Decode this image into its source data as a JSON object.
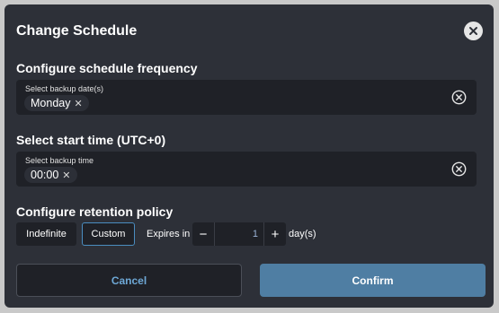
{
  "dialog": {
    "title": "Change Schedule",
    "close_icon": "close-icon"
  },
  "frequency": {
    "heading": "Configure schedule frequency",
    "field_label": "Select backup date(s)",
    "chips": [
      "Monday"
    ],
    "clear_icon": "circle-x-icon"
  },
  "start_time": {
    "heading": "Select start time (UTC+0)",
    "field_label": "Select backup time",
    "chips": [
      "00:00"
    ],
    "clear_icon": "circle-x-icon"
  },
  "retention": {
    "heading": "Configure retention policy",
    "options": [
      "Indefinite",
      "Custom"
    ],
    "selected": "Custom",
    "expires_label": "Expires in",
    "days_value": "1",
    "days_unit": "day(s)",
    "minus_label": "−",
    "plus_label": "+"
  },
  "actions": {
    "cancel_label": "Cancel",
    "confirm_label": "Confirm"
  },
  "colors": {
    "dialog_bg": "#2d3038",
    "field_bg": "#1f2127",
    "accent": "#4a8dc0",
    "confirm_bg": "#4f7ea3",
    "cancel_text": "#6ea8d6"
  }
}
